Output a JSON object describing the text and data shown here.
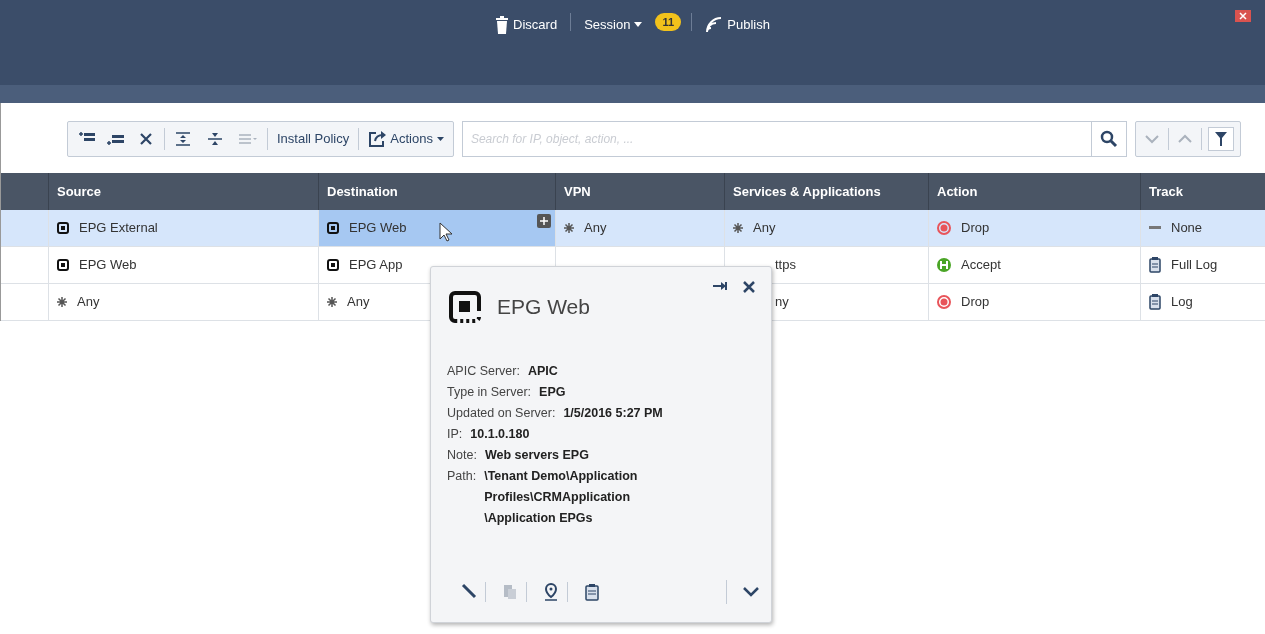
{
  "top_bar": {
    "discard": "Discard",
    "session": "Session",
    "session_count": "11",
    "publish": "Publish"
  },
  "toolbar": {
    "install_policy": "Install Policy",
    "actions": "Actions",
    "search": {
      "placeholder": "Search for IP, object, action, ..."
    }
  },
  "table": {
    "columns": [
      "Source",
      "Destination",
      "VPN",
      "Services & Applications",
      "Action",
      "Track"
    ],
    "rows": [
      {
        "selected": true,
        "cells": [
          {
            "kind": "epg",
            "text": "EPG External",
            "focused": false
          },
          {
            "kind": "epg",
            "text": "EPG Web",
            "focused": true
          },
          {
            "kind": "any",
            "text": "Any",
            "focused": false
          },
          {
            "kind": "any",
            "text": "Any",
            "focused": false
          },
          {
            "kind": "drop",
            "text": "Drop",
            "focused": false
          },
          {
            "kind": "none",
            "text": "None",
            "focused": false
          }
        ]
      },
      {
        "selected": false,
        "cells": [
          {
            "kind": "epg",
            "text": "EPG Web",
            "focused": false
          },
          {
            "kind": "epg",
            "text": "EPG App",
            "focused": false
          },
          {
            "kind": "hidden"
          },
          {
            "kind": "partial",
            "text": "ttps",
            "focused": false
          },
          {
            "kind": "accept",
            "text": "Accept",
            "focused": false
          },
          {
            "kind": "log",
            "text": "Full Log",
            "focused": false
          }
        ]
      },
      {
        "selected": false,
        "cells": [
          {
            "kind": "any",
            "text": "Any",
            "focused": false
          },
          {
            "kind": "any",
            "text": "Any",
            "focused": false
          },
          {
            "kind": "hidden"
          },
          {
            "kind": "partial",
            "text": "ny",
            "focused": false
          },
          {
            "kind": "drop",
            "text": "Drop",
            "focused": false
          },
          {
            "kind": "log",
            "text": "Log",
            "focused": false
          }
        ]
      }
    ]
  },
  "popup": {
    "title": "EPG Web",
    "fields": [
      {
        "label": "APIC Server:",
        "value": "APIC"
      },
      {
        "label": "Type in Server:",
        "value": "EPG"
      },
      {
        "label": "Updated on Server:",
        "value": "1/5/2016 5:27 PM"
      },
      {
        "label": "IP:",
        "value": "10.1.0.180"
      },
      {
        "label": "Note:",
        "value": "Web servers EPG"
      },
      {
        "label": "Path:",
        "value": "\\Tenant Demo\\Application Profiles\\CRMApplication \\Application EPGs"
      }
    ]
  }
}
